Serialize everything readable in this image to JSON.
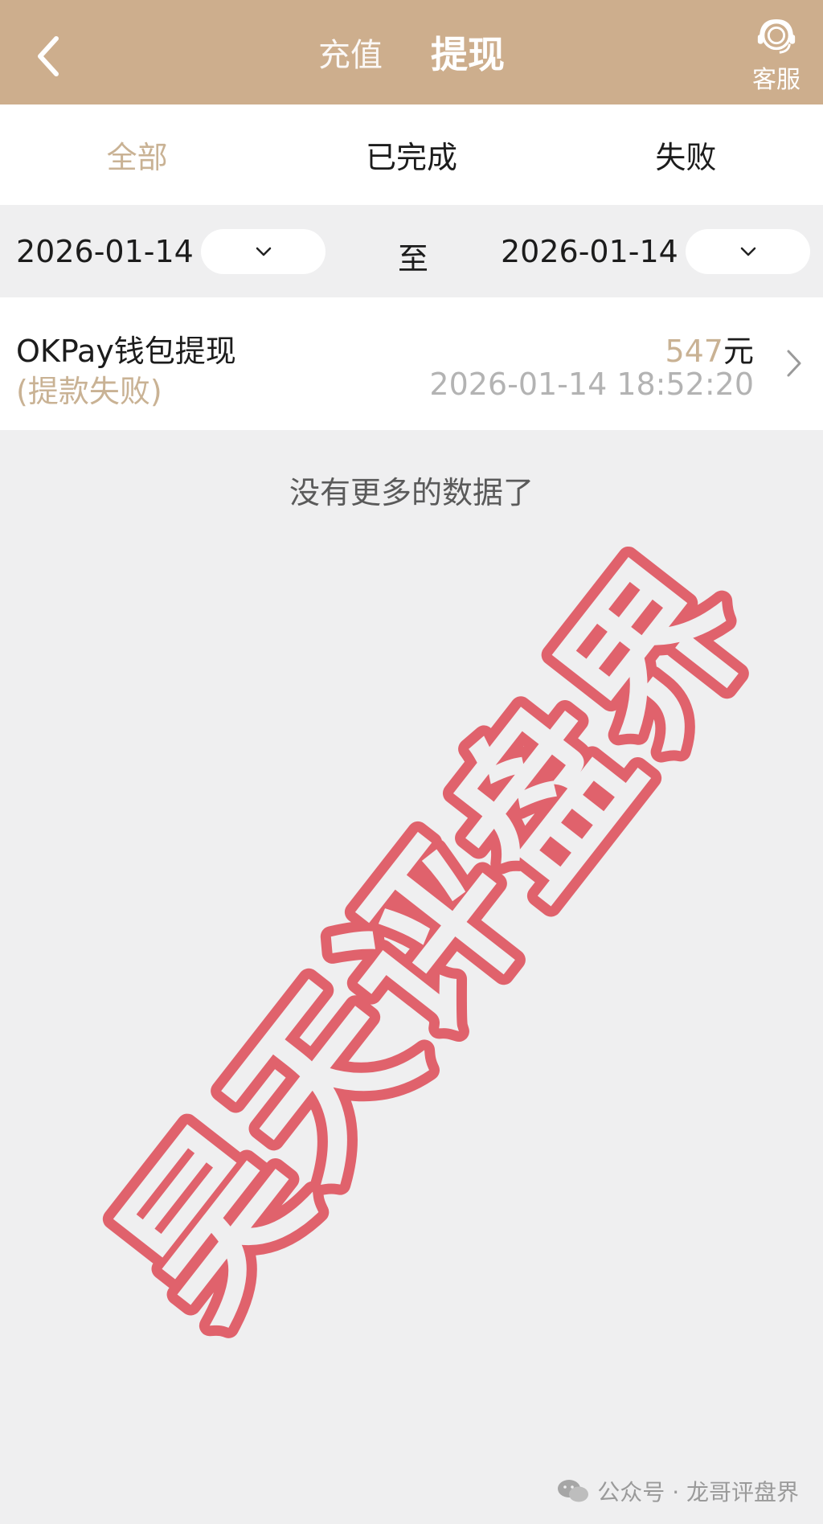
{
  "header": {
    "back_icon": "chevron-left-icon",
    "tabs": [
      {
        "label": "充值",
        "active": false
      },
      {
        "label": "提现",
        "active": true
      }
    ],
    "support_label": "客服",
    "support_icon": "headset-icon",
    "background_color": "#cdae8d"
  },
  "filters": {
    "tabs": [
      {
        "label": "全部",
        "selected": true
      },
      {
        "label": "已完成",
        "selected": false
      },
      {
        "label": "失败",
        "selected": false
      }
    ],
    "accent_color": "#c9b294"
  },
  "date_range": {
    "start": "2026-01-14",
    "separator": "至",
    "end": "2026-01-14",
    "dropdown_icon": "chevron-down-icon"
  },
  "records": [
    {
      "title": "OKPay钱包提现",
      "status": "(提款失败)",
      "amount": "547",
      "unit": "元",
      "time": "2026-01-14 18:52:20"
    }
  ],
  "list_end_text": "没有更多的数据了",
  "stamp_text": "昊天评盘界",
  "footer_watermark": {
    "icon": "wechat-icon",
    "text": "公众号 · 龙哥评盘界"
  }
}
